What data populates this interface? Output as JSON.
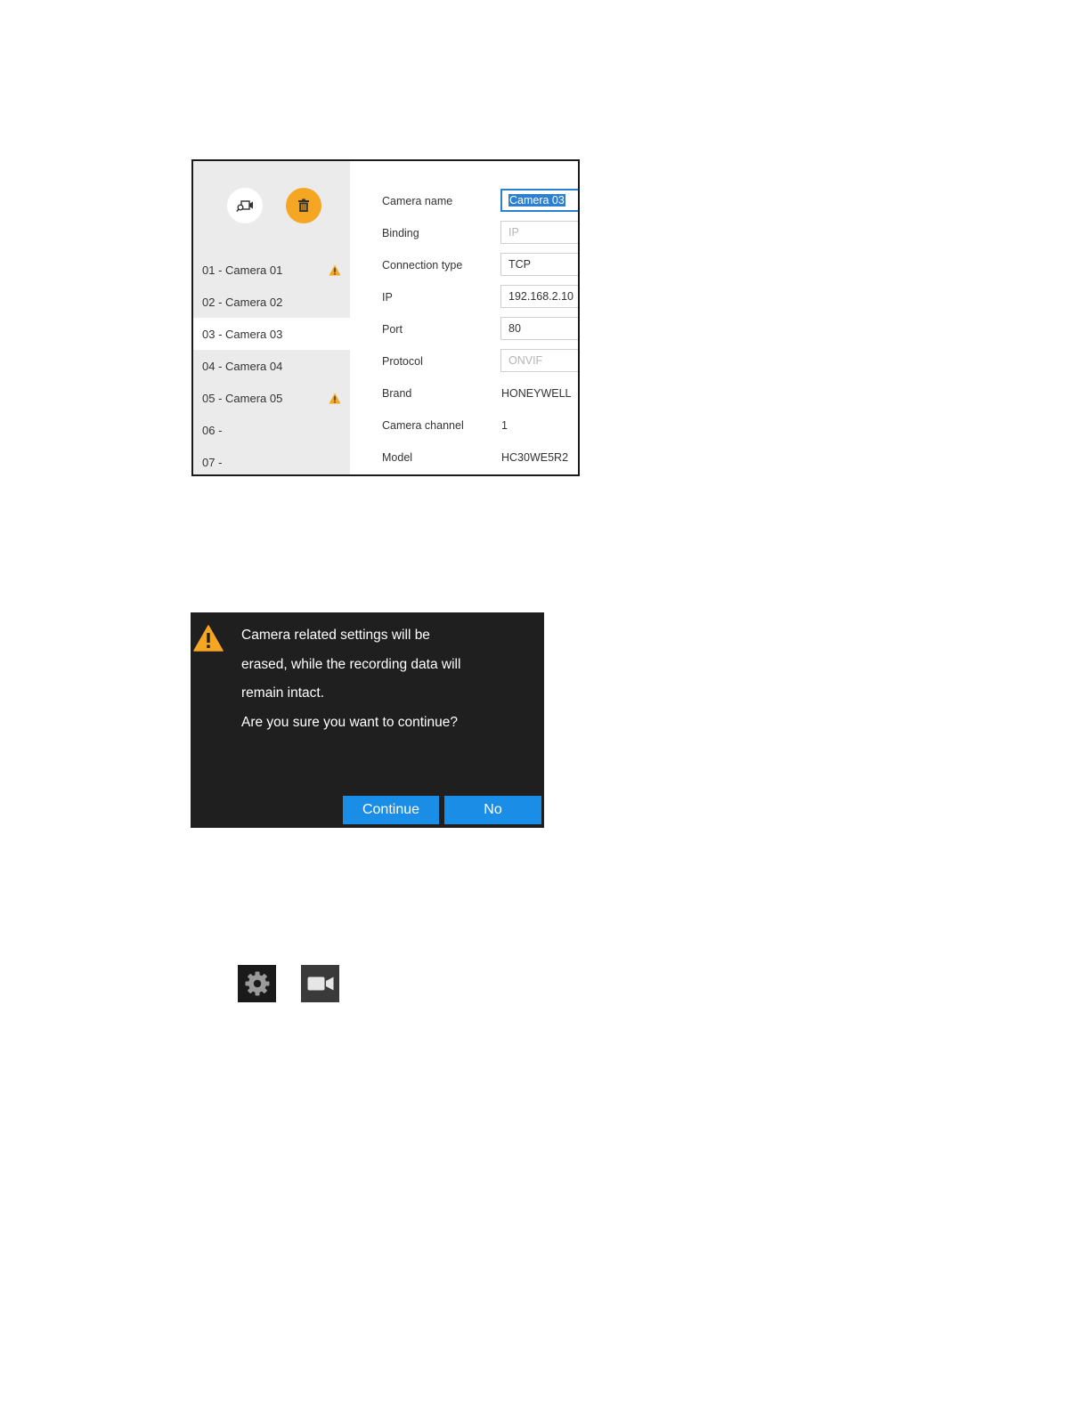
{
  "camera_list": {
    "search_icon": "camera-search-icon",
    "delete_icon": "trash-icon",
    "items": [
      {
        "label": "01 - Camera 01",
        "warning": true
      },
      {
        "label": "02 - Camera 02",
        "warning": false
      },
      {
        "label": "03 - Camera 03",
        "warning": false,
        "selected": true
      },
      {
        "label": "04 - Camera 04",
        "warning": false
      },
      {
        "label": "05 - Camera 05",
        "warning": true
      },
      {
        "label": "06 -",
        "warning": false
      },
      {
        "label": "07 -",
        "warning": false
      }
    ]
  },
  "form": {
    "camera_name_label": "Camera name",
    "camera_name_value": "Camera 03",
    "binding_label": "Binding",
    "binding_value": "IP",
    "connection_type_label": "Connection type",
    "connection_type_value": "TCP",
    "ip_label": "IP",
    "ip_value": "192.168.2.10",
    "port_label": "Port",
    "port_value": "80",
    "protocol_label": "Protocol",
    "protocol_value": "ONVIF",
    "brand_label": "Brand",
    "brand_value": "HONEYWELL",
    "camera_channel_label": "Camera channel",
    "camera_channel_value": "1",
    "model_label": "Model",
    "model_value": "HC30WE5R2"
  },
  "dialog": {
    "line1": "Camera related settings will be",
    "line2": "erased, while the recording data will",
    "line3": "remain intact.",
    "line4": "Are you sure you want to continue?",
    "continue_label": "Continue",
    "no_label": "No"
  },
  "icons": {
    "settings": "gear-icon",
    "camera": "video-camera-icon"
  },
  "colors": {
    "accent_orange": "#f5a623",
    "button_blue": "#1a8ee6",
    "selection_blue": "#2d7fd0",
    "dialog_bg": "#1f1f1f",
    "list_bg": "#ebebeb"
  }
}
